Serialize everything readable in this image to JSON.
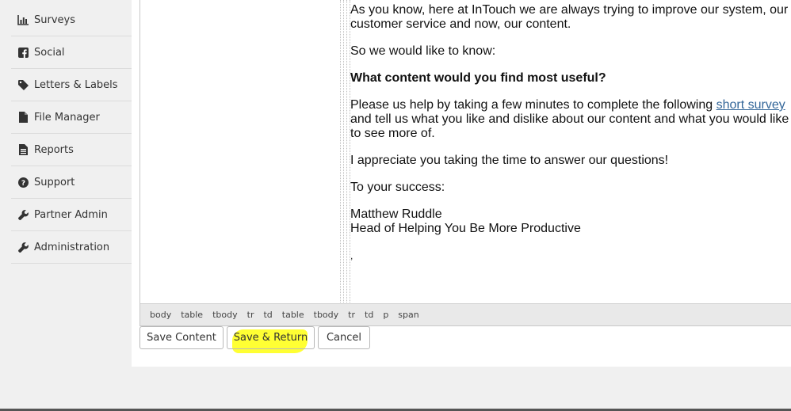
{
  "sidebar": {
    "items": [
      {
        "label": "Surveys",
        "icon": "bar-chart-icon"
      },
      {
        "label": "Social",
        "icon": "facebook-icon"
      },
      {
        "label": "Letters & Labels",
        "icon": "tag-icon"
      },
      {
        "label": "File Manager",
        "icon": "file-icon"
      },
      {
        "label": "Reports",
        "icon": "report-icon"
      },
      {
        "label": "Support",
        "icon": "question-circle-icon"
      },
      {
        "label": "Partner Admin",
        "icon": "wrench-icon"
      },
      {
        "label": "Administration",
        "icon": "wrench-icon"
      }
    ]
  },
  "email": {
    "para1": "As you know, here at InTouch we are always trying to improve our system, our customer service and now, our content.",
    "para2": "So we would like to know:",
    "heading": "What content would you find most useful?",
    "para3_pre": "Please us help by taking a few minutes to complete the following ",
    "para3_link": "short survey ",
    "para3_post": "and tell us what you like and dislike about our content and what you would like to see more of.",
    "para4": "I appreciate you taking the time to answer our questions!",
    "para5": "To your success:",
    "signature_name": "Matthew Ruddle",
    "signature_title": "Head of Helping You Be More Productive",
    "trailing": ","
  },
  "status_bar": {
    "path": [
      "body",
      "table",
      "tbody",
      "tr",
      "td",
      "table",
      "tbody",
      "tr",
      "td",
      "p",
      "span"
    ]
  },
  "buttons": {
    "save_content": "Save Content",
    "save_return": "Save & Return",
    "cancel": "Cancel"
  },
  "colors": {
    "highlight": "#ffff33",
    "link": "#336699"
  }
}
